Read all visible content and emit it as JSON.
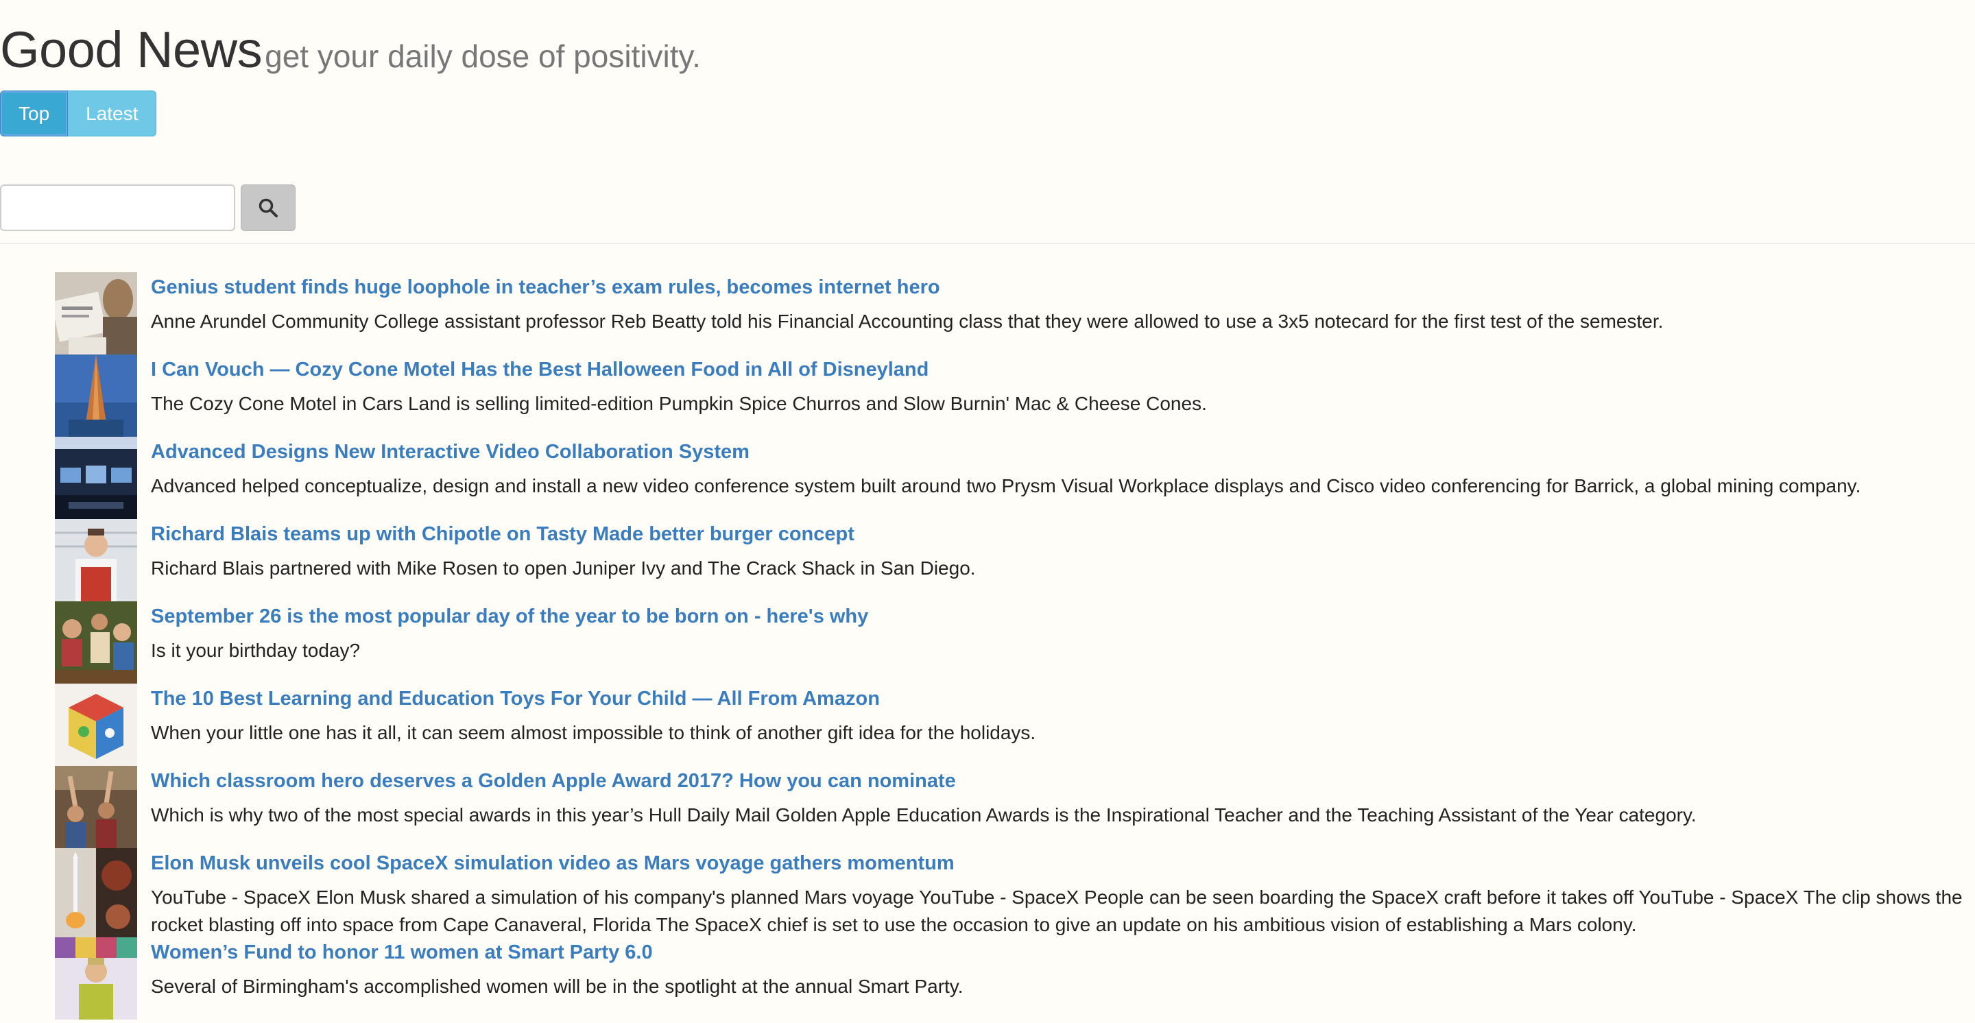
{
  "header": {
    "title": "Good News",
    "tagline": "get your daily dose of positivity."
  },
  "tabs": [
    {
      "label": "Top",
      "active": true
    },
    {
      "label": "Latest",
      "active": false
    }
  ],
  "search": {
    "value": "",
    "placeholder": "",
    "icon": "search-icon"
  },
  "articles": [
    {
      "headline": "Genius student finds huge loophole in teacher’s exam rules, becomes internet hero",
      "summary": "Anne Arundel Community College assistant professor Reb Beatty told his Financial Accounting class that they were allowed to use a 3x5 notecard for the first test of the semester."
    },
    {
      "headline": "I Can Vouch — Cozy Cone Motel Has the Best Halloween Food in All of Disneyland",
      "summary": "The Cozy Cone Motel in Cars Land is selling limited-edition Pumpkin Spice Churros and Slow Burnin' Mac & Cheese Cones."
    },
    {
      "headline": "Advanced Designs New Interactive Video Collaboration System",
      "summary": "Advanced helped conceptualize, design and install a new video conference system built around two Prysm Visual Workplace displays and Cisco video conferencing for Barrick, a global mining company."
    },
    {
      "headline": "Richard Blais teams up with Chipotle on Tasty Made better burger concept",
      "summary": "Richard Blais partnered with Mike Rosen to open Juniper Ivy and The Crack Shack in San Diego."
    },
    {
      "headline": "September 26 is the most popular day of the year to be born on - here's why",
      "summary": "Is it your birthday today?"
    },
    {
      "headline": "The 10 Best Learning and Education Toys For Your Child — All From Amazon",
      "summary": "When your little one has it all, it can seem almost impossible to think of another gift idea for the holidays."
    },
    {
      "headline": "Which classroom hero deserves a Golden Apple Award 2017? How you can nominate",
      "summary": "Which is why two of the most special awards in this year’s Hull Daily Mail Golden Apple Education Awards is the Inspirational Teacher and the Teaching Assistant of the Year category."
    },
    {
      "headline": "Elon Musk unveils cool SpaceX simulation video as Mars voyage gathers momentum",
      "summary": "YouTube - SpaceX Elon Musk shared a simulation of his company's planned Mars voyage YouTube - SpaceX People can be seen boarding the SpaceX craft before it takes off YouTube - SpaceX The clip shows the rocket blasting off into space from Cape Canaveral, Florida The SpaceX chief is set to use the occasion to give an update on his ambitious vision of establishing a Mars colony."
    },
    {
      "headline": "Women’s Fund to honor 11 women at Smart Party 6.0",
      "summary": "Several of Birmingham's accomplished women will be in the spotlight at the annual Smart Party."
    }
  ]
}
